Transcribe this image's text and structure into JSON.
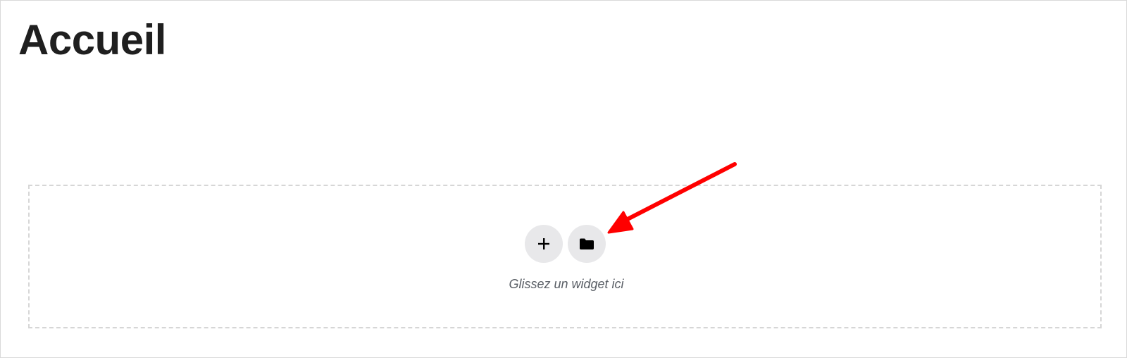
{
  "page": {
    "title": "Accueil"
  },
  "drop_zone": {
    "hint": "Glissez un widget ici",
    "add_icon": "plus-icon",
    "folder_icon": "folder-icon"
  },
  "annotation": {
    "arrow_color": "#ff0000"
  },
  "colors": {
    "button_background": "#e8e8ea",
    "border": "#d6d6d6",
    "title": "#1f1f1f",
    "hint": "#5a5f66"
  }
}
